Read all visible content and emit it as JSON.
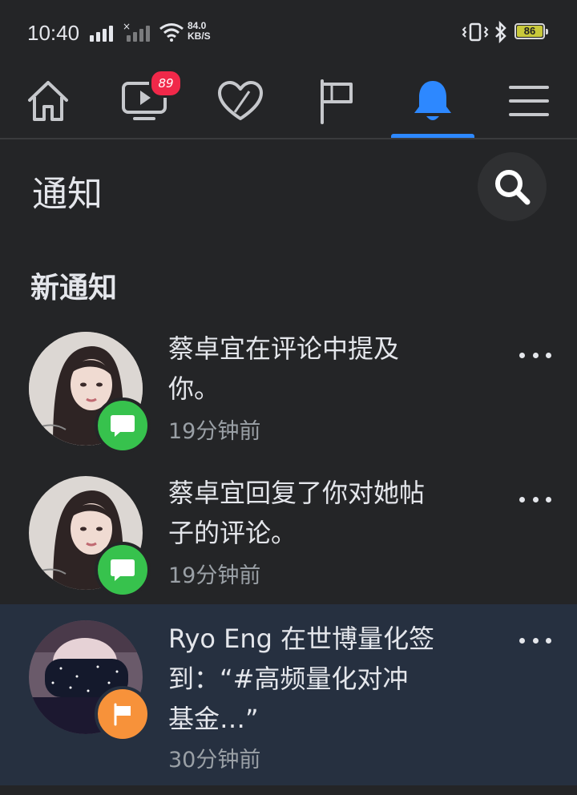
{
  "status_bar": {
    "time": "10:40",
    "net_speed_value": "84.0",
    "net_speed_unit": "KB/S",
    "battery": "86"
  },
  "nav": {
    "tabs": [
      {
        "name": "home",
        "icon": "home-icon"
      },
      {
        "name": "watch",
        "icon": "video-icon",
        "badge": "89"
      },
      {
        "name": "dating",
        "icon": "heart-icon"
      },
      {
        "name": "pages",
        "icon": "flag-icon"
      },
      {
        "name": "notifications",
        "icon": "bell-icon",
        "active": true
      },
      {
        "name": "menu",
        "icon": "menu-icon"
      }
    ],
    "active_color": "#2d88ff"
  },
  "header": {
    "title": "通知"
  },
  "section": {
    "title": "新通知"
  },
  "notifications": [
    {
      "line1": "蔡卓宜在评论中提及",
      "line2": "你。",
      "time": "19分钟前",
      "badge_icon": "comment-icon",
      "badge_color": "#37c24d"
    },
    {
      "line1": "蔡卓宜回复了你对她帖",
      "line2": "子的评论。",
      "time": "19分钟前",
      "badge_icon": "comment-icon",
      "badge_color": "#37c24d"
    },
    {
      "line1": "Ryo Eng 在世博量化签",
      "line2": "到：“#高频量化对冲",
      "line3": "基金…”",
      "time": "30分钟前",
      "badge_icon": "flag-icon",
      "badge_color": "#f7923a",
      "unread": true
    }
  ]
}
